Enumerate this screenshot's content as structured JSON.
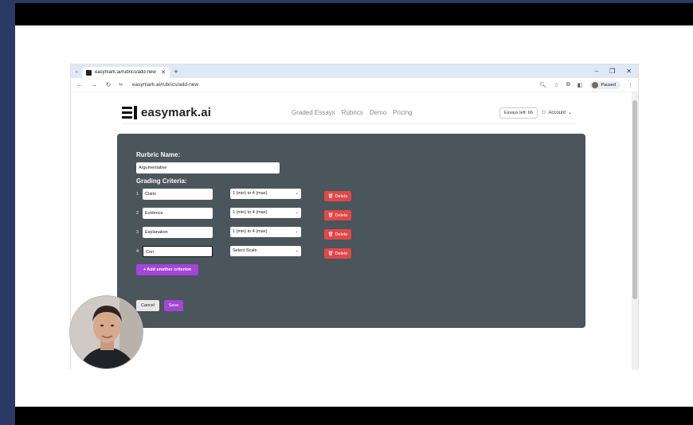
{
  "browser": {
    "tab_title": "easymark.ai/rubrics/add-new",
    "url": "easymark.ai/rubrics/add-new",
    "profile_status": "Paused"
  },
  "site": {
    "logo": "easymark.ai",
    "nav": [
      "Graded Essays",
      "Rubrics",
      "Demo",
      "Pricing"
    ],
    "essays_left": "Essays left: 66",
    "account": "Account"
  },
  "form": {
    "rubric_name_label": "Rurbric Name:",
    "rubric_name_value": "Argumentative",
    "grading_criteria_label": "Grading Criteria:",
    "criteria": [
      {
        "num": "1",
        "name": "Claim",
        "scale": "1 (min) to 4 (max)"
      },
      {
        "num": "2",
        "name": "Evidence",
        "scale": "1 (min) to 4 (max)"
      },
      {
        "num": "3",
        "name": "Explanation",
        "scale": "1 (min) to 4 (max)"
      },
      {
        "num": "4",
        "name": "Con",
        "scale": "Select Scale"
      }
    ],
    "delete_label": "Delete",
    "add_label": "+ Add another criterion",
    "cancel_label": "Cancel",
    "save_label": "Save"
  },
  "colors": {
    "card_bg": "#4a555c",
    "accent_purple": "#a544d9",
    "delete_red": "#e04848",
    "frame_blue": "#2a3a63"
  }
}
